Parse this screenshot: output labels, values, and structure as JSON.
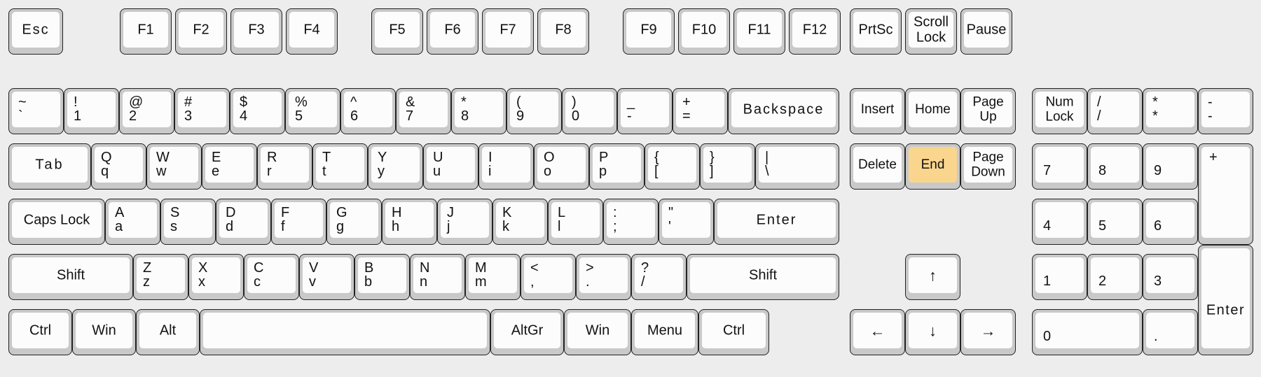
{
  "keyboard": {
    "name": "full-size-104-key-layout",
    "background_color": "#ededed",
    "key_face_color": "#fcfcfc",
    "key_bezel_color": "#c9c9c9",
    "highlight_color": "#fad58e",
    "highlighted_key": "End",
    "function_row": [
      {
        "label": "Esc"
      },
      {
        "label": "F1"
      },
      {
        "label": "F2"
      },
      {
        "label": "F3"
      },
      {
        "label": "F4"
      },
      {
        "label": "F5"
      },
      {
        "label": "F6"
      },
      {
        "label": "F7"
      },
      {
        "label": "F8"
      },
      {
        "label": "F9"
      },
      {
        "label": "F10"
      },
      {
        "label": "F11"
      },
      {
        "label": "F12"
      },
      {
        "label": "PrtSc"
      },
      {
        "label_top": "Scroll",
        "label_bottom": "Lock"
      },
      {
        "label": "Pause"
      }
    ],
    "number_row": [
      {
        "shift": "~",
        "base": "`"
      },
      {
        "shift": "!",
        "base": "1"
      },
      {
        "shift": "@",
        "base": "2"
      },
      {
        "shift": "#",
        "base": "3"
      },
      {
        "shift": "$",
        "base": "4"
      },
      {
        "shift": "%",
        "base": "5"
      },
      {
        "shift": "^",
        "base": "6"
      },
      {
        "shift": "&",
        "base": "7"
      },
      {
        "shift": "*",
        "base": "8"
      },
      {
        "shift": "(",
        "base": "9"
      },
      {
        "shift": ")",
        "base": "0"
      },
      {
        "shift": "_",
        "base": "-"
      },
      {
        "shift": "+",
        "base": "="
      },
      {
        "label": "Backspace"
      }
    ],
    "tab_row": [
      {
        "label": "Tab"
      },
      {
        "shift": "Q",
        "base": "q"
      },
      {
        "shift": "W",
        "base": "w"
      },
      {
        "shift": "E",
        "base": "e"
      },
      {
        "shift": "R",
        "base": "r"
      },
      {
        "shift": "T",
        "base": "t"
      },
      {
        "shift": "Y",
        "base": "y"
      },
      {
        "shift": "U",
        "base": "u"
      },
      {
        "shift": "I",
        "base": "i"
      },
      {
        "shift": "O",
        "base": "o"
      },
      {
        "shift": "P",
        "base": "p"
      },
      {
        "shift": "{",
        "base": "["
      },
      {
        "shift": "}",
        "base": "]"
      },
      {
        "shift": "|",
        "base": "\\"
      }
    ],
    "caps_row": [
      {
        "label": "Caps Lock"
      },
      {
        "shift": "A",
        "base": "a"
      },
      {
        "shift": "S",
        "base": "s"
      },
      {
        "shift": "D",
        "base": "d"
      },
      {
        "shift": "F",
        "base": "f"
      },
      {
        "shift": "G",
        "base": "g"
      },
      {
        "shift": "H",
        "base": "h"
      },
      {
        "shift": "J",
        "base": "j"
      },
      {
        "shift": "K",
        "base": "k"
      },
      {
        "shift": "L",
        "base": "l"
      },
      {
        "shift": ":",
        "base": ";"
      },
      {
        "shift": "\"",
        "base": "'"
      },
      {
        "label": "Enter"
      }
    ],
    "shift_row": [
      {
        "label": "Shift"
      },
      {
        "shift": "Z",
        "base": "z"
      },
      {
        "shift": "X",
        "base": "x"
      },
      {
        "shift": "C",
        "base": "c"
      },
      {
        "shift": "V",
        "base": "v"
      },
      {
        "shift": "B",
        "base": "b"
      },
      {
        "shift": "N",
        "base": "n"
      },
      {
        "shift": "M",
        "base": "m"
      },
      {
        "shift": "<",
        "base": ","
      },
      {
        "shift": ">",
        "base": "."
      },
      {
        "shift": "?",
        "base": "/"
      },
      {
        "label": "Shift"
      }
    ],
    "bottom_row": [
      {
        "label": "Ctrl"
      },
      {
        "label": "Win"
      },
      {
        "label": "Alt"
      },
      {
        "label": ""
      },
      {
        "label": "AltGr"
      },
      {
        "label": "Win"
      },
      {
        "label": "Menu"
      },
      {
        "label": "Ctrl"
      }
    ],
    "nav_cluster": [
      {
        "label": "Insert"
      },
      {
        "label": "Home"
      },
      {
        "label_top": "Page",
        "label_bottom": "Up"
      },
      {
        "label": "Delete"
      },
      {
        "label": "End",
        "highlighted": true
      },
      {
        "label_top": "Page",
        "label_bottom": "Down"
      }
    ],
    "arrow_cluster": [
      {
        "label": "↑",
        "name": "arrow-up"
      },
      {
        "label": "←",
        "name": "arrow-left"
      },
      {
        "label": "↓",
        "name": "arrow-down"
      },
      {
        "label": "→",
        "name": "arrow-right"
      }
    ],
    "numpad": [
      {
        "label_top": "Num",
        "label_bottom": "Lock"
      },
      {
        "shift": "/",
        "base": "/"
      },
      {
        "shift": "*",
        "base": "*"
      },
      {
        "shift": "-",
        "base": "-"
      },
      {
        "label": "7"
      },
      {
        "label": "8"
      },
      {
        "label": "9"
      },
      {
        "label": "+"
      },
      {
        "label": "4"
      },
      {
        "label": "5"
      },
      {
        "label": "6"
      },
      {
        "label": "1"
      },
      {
        "label": "2"
      },
      {
        "label": "3"
      },
      {
        "label": "Enter"
      },
      {
        "label": "0"
      },
      {
        "label": "."
      }
    ]
  }
}
